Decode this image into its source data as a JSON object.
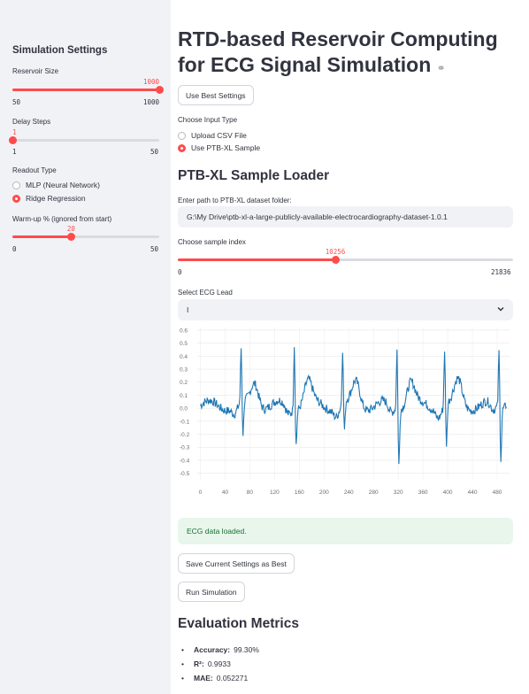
{
  "sidebar": {
    "title": "Simulation Settings",
    "reservoir": {
      "label": "Reservoir Size",
      "value": 1000,
      "min": 50,
      "max": 1000,
      "value_text": "1000",
      "min_text": "50",
      "max_text": "1000"
    },
    "delay": {
      "label": "Delay Steps",
      "value": 1,
      "min": 1,
      "max": 50,
      "value_text": "1",
      "min_text": "1",
      "max_text": "50"
    },
    "readout": {
      "label": "Readout Type",
      "options": [
        "MLP (Neural Network)",
        "Ridge Regression"
      ],
      "selected": 1
    },
    "warmup": {
      "label": "Warm-up % (ignored from start)",
      "value": 20,
      "min": 0,
      "max": 50,
      "value_text": "20",
      "min_text": "0",
      "max_text": "50"
    }
  },
  "main": {
    "title_line1": "RTD-based Reservoir Computing",
    "title_line2": "for ECG Signal Simulation",
    "use_best_button": "Use Best Settings",
    "input_type": {
      "label": "Choose Input Type",
      "options": [
        "Upload CSV File",
        "Use PTB-XL Sample"
      ],
      "selected": 1
    },
    "loader_heading": "PTB-XL Sample Loader",
    "path_label": "Enter path to PTB-XL dataset folder:",
    "path_value": "G:\\My Drive\\ptb-xl-a-large-publicly-available-electrocardiography-dataset-1.0.1",
    "sample_index": {
      "label": "Choose sample index",
      "value": 10256,
      "min": 0,
      "max": 21836,
      "value_text": "10256",
      "min_text": "0",
      "max_text": "21836"
    },
    "lead": {
      "label": "Select ECG Lead",
      "value": "I"
    },
    "success_message": "ECG data loaded.",
    "save_button": "Save Current Settings as Best",
    "run_button": "Run Simulation",
    "metrics_heading": "Evaluation Metrics",
    "metrics": [
      {
        "name": "Accuracy:",
        "value": "99.30%"
      },
      {
        "name": "R²:",
        "value": "0.9933"
      },
      {
        "name": "MAE:",
        "value": "0.052271"
      }
    ]
  },
  "chart_data": {
    "type": "line",
    "xlim": [
      -5,
      500
    ],
    "ylim": [
      -0.55,
      0.62
    ],
    "xticks": [
      0,
      40,
      80,
      120,
      160,
      200,
      240,
      280,
      320,
      360,
      400,
      440,
      480
    ],
    "yticks": [
      0.6,
      0.5,
      0.4,
      0.3,
      0.2,
      0.1,
      0.0,
      -0.1,
      -0.2,
      -0.3,
      -0.4,
      -0.5
    ],
    "ytick_labels": [
      "0.6",
      "0.5",
      "0.4",
      "0.3",
      "0.2",
      "0.1",
      "0.0",
      "-0.1",
      "-0.2",
      "-0.3",
      "-0.4",
      "-0.5"
    ],
    "grid": true,
    "color": "#1f77b4",
    "beats": [
      {
        "x": 66,
        "peak": 0.42,
        "trough": -0.26
      },
      {
        "x": 152,
        "peak": 0.52,
        "trough": -0.27
      },
      {
        "x": 230,
        "peak": 0.43,
        "trough": -0.22
      },
      {
        "x": 318,
        "peak": 0.47,
        "trough": -0.43
      },
      {
        "x": 395,
        "peak": 0.45,
        "trough": -0.31
      },
      {
        "x": 483,
        "peak": 0.44,
        "trough": -0.39
      }
    ]
  }
}
